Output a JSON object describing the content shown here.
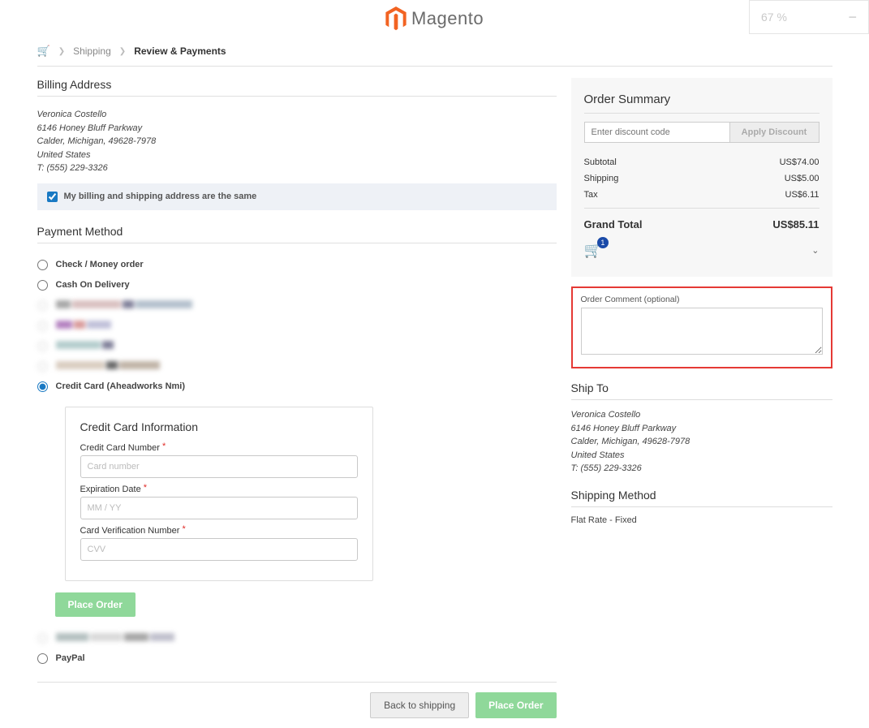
{
  "zoom": "67 %",
  "logo_text": "Magento",
  "breadcrumbs": {
    "shipping": "Shipping",
    "review": "Review & Payments"
  },
  "billing": {
    "title": "Billing Address",
    "name": "Veronica Costello",
    "street": "6146 Honey Bluff Parkway",
    "city": "Calder, Michigan, 49628-7978",
    "country": "United States",
    "phone": "T: (555) 229-3326",
    "same_label": "My billing and shipping address are the same"
  },
  "payment": {
    "title": "Payment Method",
    "check": "Check / Money order",
    "cod": "Cash On Delivery",
    "cc_nmi": "Credit Card (Aheadworks Nmi)",
    "paypal": "PayPal"
  },
  "cc": {
    "title": "Credit Card Information",
    "num_label": "Credit Card Number",
    "num_ph": "Card number",
    "exp_label": "Expiration Date",
    "exp_ph": "MM / YY",
    "cvv_label": "Card Verification Number",
    "cvv_ph": "CVV"
  },
  "buttons": {
    "place": "Place Order",
    "back": "Back to shipping",
    "apply": "Apply Discount"
  },
  "summary": {
    "title": "Order Summary",
    "discount_ph": "Enter discount code",
    "subtotal_l": "Subtotal",
    "subtotal_v": "US$74.00",
    "shipping_l": "Shipping",
    "shipping_v": "US$5.00",
    "tax_l": "Tax",
    "tax_v": "US$6.11",
    "grand_l": "Grand Total",
    "grand_v": "US$85.11",
    "cart_count": "1"
  },
  "comment": {
    "label": "Order Comment (optional)"
  },
  "shipto": {
    "title": "Ship To",
    "name": "Veronica Costello",
    "street": "6146 Honey Bluff Parkway",
    "city": "Calder, Michigan, 49628-7978",
    "country": "United States",
    "phone": "T: (555) 229-3326"
  },
  "shipmethod": {
    "title": "Shipping Method",
    "value": "Flat Rate - Fixed"
  }
}
